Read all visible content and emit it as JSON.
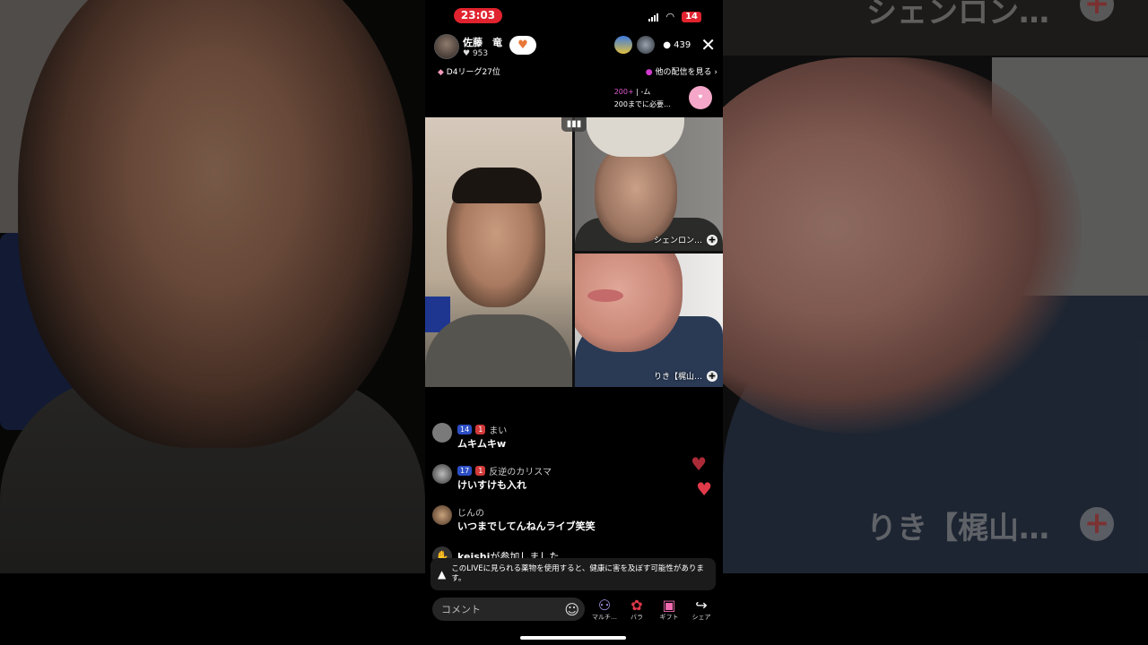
{
  "status": {
    "time": "23:03",
    "battery": "14"
  },
  "host": {
    "name": "佐藤　竜",
    "likes": "953"
  },
  "viewers": {
    "count": "439"
  },
  "league": "D4リーグ27位",
  "other_live": "他の配信を見る",
  "rank": {
    "line1_pink": "200+",
    "line1_rest": "| -ム",
    "line2": "200までに必要…"
  },
  "tiles": {
    "top_right_name": "シェンロン…",
    "bottom_right_name": "りき【梶山…"
  },
  "background_captions": {
    "top": "シェンロン…",
    "bottom": "りき【梶山…"
  },
  "comments": [
    {
      "badge_level": "14",
      "badge_heart": "1",
      "user": "まい",
      "text": "ムキムキw"
    },
    {
      "badge_level": "17",
      "badge_heart": "1",
      "user": "反逆のカリスマ",
      "text": "けいすけも入れ"
    },
    {
      "user": "じんの",
      "text": "いつまでしてんねんライブ笑笑"
    }
  ],
  "joined": {
    "user": "keishi",
    "suffix": "が参加しました"
  },
  "warning": "このLIVEに見られる薬物を使用すると、健康に害を及ぼす可能性があります。",
  "comment_placeholder": "コメント",
  "actions": {
    "multi": "マルチ…",
    "rose": "バラ",
    "gift": "ギフト",
    "share": "シェア"
  },
  "colors": {
    "accent_red": "#e0232e",
    "heart": "#e33a4a",
    "level_badge": "#2c4ec4"
  }
}
